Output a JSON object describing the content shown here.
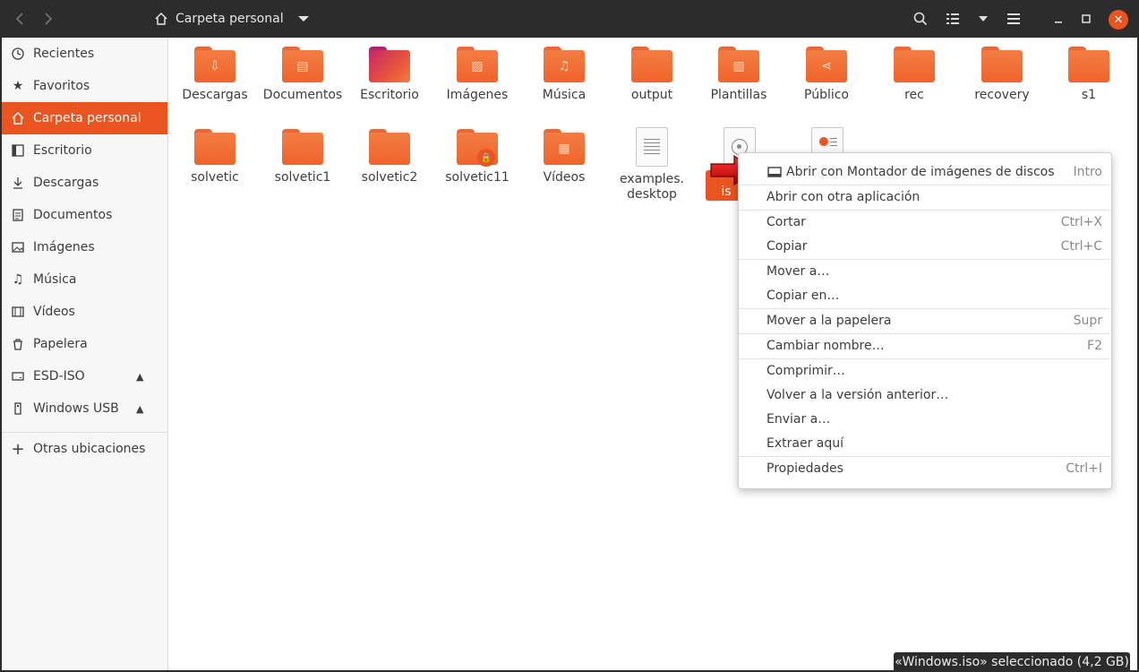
{
  "header": {
    "title": "Carpeta personal",
    "back_icon": "chevron-left-icon",
    "forward_icon": "chevron-right-icon"
  },
  "sidebar": {
    "items": [
      {
        "label": "Recientes",
        "icon": "clock-icon"
      },
      {
        "label": "Favoritos",
        "icon": "star-icon"
      },
      {
        "label": "Carpeta personal",
        "icon": "home-icon",
        "active": true
      },
      {
        "label": "Escritorio",
        "icon": "desktop-icon"
      },
      {
        "label": "Descargas",
        "icon": "download-icon"
      },
      {
        "label": "Documentos",
        "icon": "document-icon"
      },
      {
        "label": "Imágenes",
        "icon": "image-icon"
      },
      {
        "label": "Música",
        "icon": "music-icon"
      },
      {
        "label": "Vídeos",
        "icon": "video-icon"
      },
      {
        "label": "Papelera",
        "icon": "trash-icon"
      },
      {
        "label": "ESD-ISO",
        "icon": "drive-icon",
        "eject": true
      },
      {
        "label": "Windows USB",
        "icon": "usb-icon",
        "eject": true
      }
    ],
    "other_locations": "Otras ubicaciones"
  },
  "files": {
    "row1": [
      {
        "name": "Descargas",
        "glyph": "⇩"
      },
      {
        "name": "Documentos",
        "glyph": "▤"
      },
      {
        "name": "Escritorio",
        "glyph": ""
      },
      {
        "name": "Imágenes",
        "glyph": "▨"
      },
      {
        "name": "Música",
        "glyph": "♫"
      },
      {
        "name": "output",
        "glyph": ""
      },
      {
        "name": "Plantillas",
        "glyph": "▥"
      },
      {
        "name": "Público",
        "glyph": "⋖"
      },
      {
        "name": "rec",
        "glyph": ""
      },
      {
        "name": "recovery",
        "glyph": ""
      },
      {
        "name": "s1",
        "glyph": ""
      }
    ],
    "row2": [
      {
        "name": "solvetic",
        "glyph": ""
      },
      {
        "name": "solvetic1",
        "glyph": ""
      },
      {
        "name": "solvetic2",
        "glyph": ""
      },
      {
        "name": "solvetic11",
        "glyph": "🔒"
      },
      {
        "name": "Vídeos",
        "glyph": "▦"
      },
      {
        "name": "examples.\ndesktop",
        "glyph": ""
      }
    ],
    "selected_partial": "is"
  },
  "context_menu": {
    "items": [
      {
        "label": "Abrir con Montador de imágenes de discos",
        "accel": "Intro",
        "icon": "disk-mounter-icon"
      },
      {
        "label": "Abrir con otra aplicación",
        "accel": ""
      },
      {
        "label": "Cortar",
        "accel": "Ctrl+X"
      },
      {
        "label": "Copiar",
        "accel": "Ctrl+C"
      },
      {
        "label": "Mover a…",
        "accel": ""
      },
      {
        "label": "Copiar en…",
        "accel": ""
      },
      {
        "label": "Mover a la papelera",
        "accel": "Supr"
      },
      {
        "label": "Cambiar nombre…",
        "accel": "F2"
      },
      {
        "label": "Comprimir…",
        "accel": ""
      },
      {
        "label": "Volver a la versión anterior…",
        "accel": ""
      },
      {
        "label": "Enviar a…",
        "accel": ""
      },
      {
        "label": "Extraer aquí",
        "accel": ""
      },
      {
        "label": "Propiedades",
        "accel": "Ctrl+I"
      }
    ]
  },
  "status": "«Windows.iso» seleccionado (4,2 GB)",
  "colors": {
    "accent": "#e95420",
    "folder": "#f0642a",
    "headerbar": "#2c2c2c"
  }
}
